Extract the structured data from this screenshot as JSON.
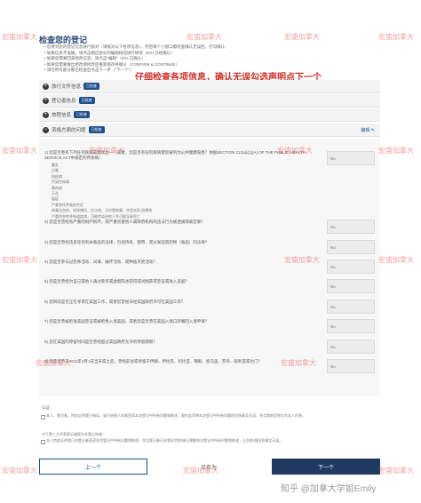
{
  "page": {
    "title": "检查您的登记",
    "intro": [
      "您要对您的登记信息进行核对（请核对以下各项信息），然后每个小窗口都检查确认无误后，打勾确认",
      "如果信息不准确，请点击相应部分的编辑按钮进行修改（E/H 已经确认）",
      "如果您需要回来修改信息，请点击\"编辑\"（E/H 已确认）",
      "如果您需要做出更改请修改后重新保存并确认（CONFIRM & CONTINUE）",
      "请在所有部分都已检查后点击下一步（\"下一个\"）"
    ],
    "annotation": "仔细检查各项信息，确认无误勾选声明点下一个"
  },
  "panels": [
    {
      "label": "旅行文件信息",
      "badge": "已检查"
    },
    {
      "label": "登记者信息",
      "badge": "已检查"
    },
    {
      "label": "旅程信息",
      "badge": "已检查"
    },
    {
      "label": "资格方面的问题",
      "badge": "已检查",
      "edit": "编辑"
    }
  ],
  "questions": {
    "q1": {
      "text": "1) 您是否患有下列任何疾病或症状之一（或者，您是否有任何疾病使您被列为公共健康隐患？依据SECTION 212(a)(1)(A) OF THE PUBLIC HEALTH SERVICE ACT中规定的传染病）",
      "items": [
        "霍乱",
        "白喉",
        "结核病",
        "传染性梅毒",
        "黄热病",
        "天花",
        "瘟疫",
        "严重急性呼吸综合征",
        "病毒出血热，如埃博拉、拉沙热、马尔堡病毒、克里米亚-刚果热",
        "严重的急性呼吸道疾病，可能传染给他人并可能导致死亡"
      ],
      "answer": "No"
    },
    "q2": {
      "text": "2) 您是否曾经有严重的财产损坏，或严重伤害他人或政府机构的违法行为被逮捕或被定罪？",
      "answer": "No"
    },
    "q3": {
      "text": "3) 您是否曾经违反任何有关毒品的法律，包括持有、使用、或分发违禁药物（毒品）的法律？",
      "answer": "No"
    },
    "q4": {
      "text": "4) 您是否参与过恐怖活动、间谍、破坏活动、或种族灭绝活动？",
      "answer": "No"
    },
    "q5": {
      "text": "5) 您是否曾经为自己或他人通过欺诈或虚假陈述获得或试图获得签证或进入美国？",
      "answer": "No"
    },
    "q6": {
      "text": "6) 您目前是否正在寻求在美国工作，或者您曾经未经美国政府许可在美国工作？",
      "answer": "No"
    },
    "q7": {
      "text": "7) 您是否曾被拒发美国签证或被拒绝入境美国，或者您是否曾在美国入境口岸撤回入境申请？",
      "answer": "No"
    },
    "q8": {
      "text": "8) 您在美国的停留时间是否曾经超过美国政府允许的停留期限？",
      "answer": "No"
    },
    "q9": {
      "text": "9) 您是否曾于2011年3月1日当天或之后，曾经前往或停留于伊朗、伊拉克、利比亚、朝鲜、索马里、苏丹、叙利亚或也门？",
      "answer": "No"
    }
  },
  "confirm": {
    "label": "认证：",
    "self": "本人，登记者，特此证明我已阅读，或已由他人向我宣读本次登记中所有问题和陈述，我在此声明本次登记中所有问题的回答真实无误，并且我的回答均为本人作答。",
    "third_label": "对于第三方代表登记者提交本登记申请：",
    "third": "本人特此证明我已向登记者宣读本次登记中所有问题和陈述，并且登记者已向我证实他/她已理解本次登记中所有问题和陈述，以及他/她回答真实无误。"
  },
  "buttons": {
    "back": "上一个",
    "save": "另存为",
    "next": "下一个"
  },
  "watermarks": [
    "宏盛加拿大",
    "宏盛加拿大",
    "宏盛加拿大",
    "宏盛加拿大",
    "宏盛加拿大",
    "宏盛加拿大",
    "宏盛加拿大",
    "宏盛加拿大",
    "宏盛加拿大",
    "宏盛加拿大",
    "宏盛加拿大",
    "宏盛加拿大",
    "宏盛加拿大",
    "宏盛加拿大",
    "宏盛加拿大",
    "宏盛加拿大"
  ],
  "footer_mark": "知乎 @加拿大学姐Emily"
}
